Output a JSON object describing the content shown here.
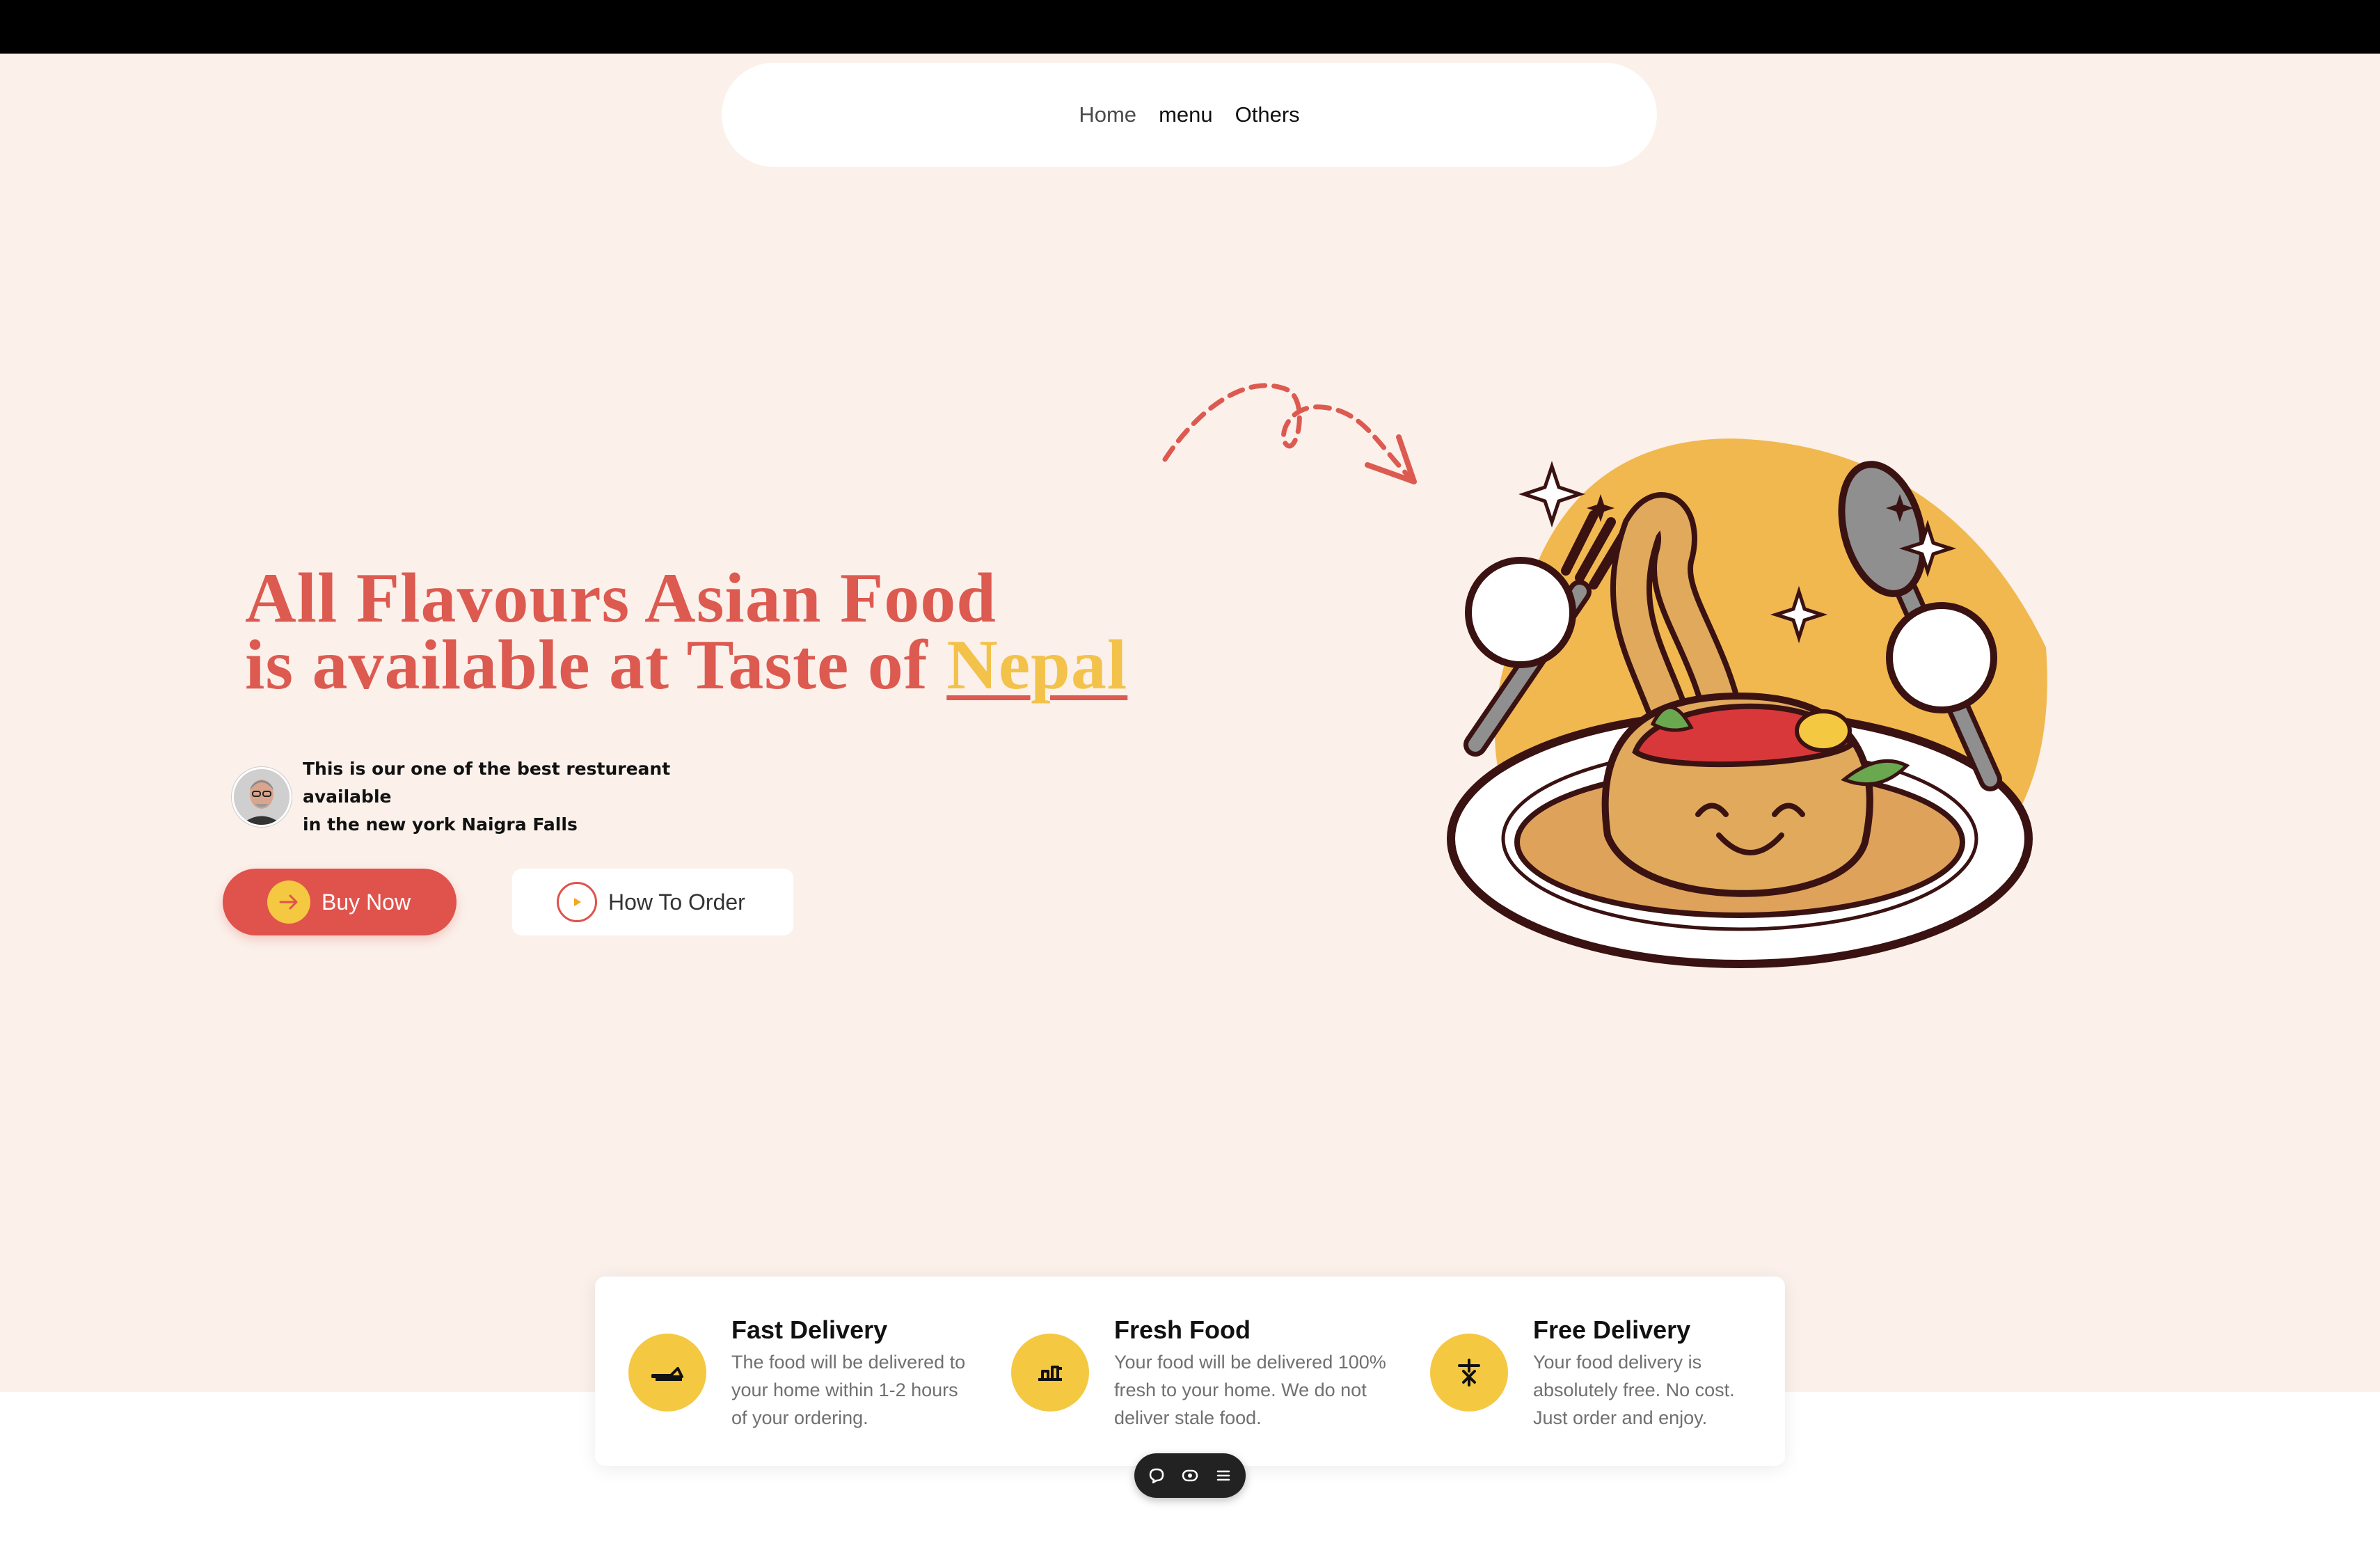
{
  "nav": {
    "items": [
      {
        "label": "Home"
      },
      {
        "label": "menu"
      },
      {
        "label": "Others"
      }
    ]
  },
  "hero": {
    "headline_line1": "All Flavours Asian Food",
    "headline_line2_prefix": "is available at Taste of ",
    "headline_highlight": "Nepal",
    "tagline_line1": "This is our one of the best restureant available",
    "tagline_line2": "in the new york Naigra Falls",
    "buy_label": "Buy Now",
    "how_label": "How To Order"
  },
  "features": [
    {
      "icon": "delivery-icon",
      "title": "Fast Delivery",
      "desc": [
        "The food will be delivered to",
        "your home within 1-2 hours",
        "of your ordering."
      ]
    },
    {
      "icon": "fresh-food-icon",
      "title": "Fresh Food",
      "desc": [
        "Your food will be delivered 100%",
        "fresh to your home. We do not",
        "deliver stale food."
      ]
    },
    {
      "icon": "free-delivery-icon",
      "title": "Free Delivery",
      "desc": [
        "Your food delivery is",
        "absolutely free. No cost.",
        "Just order and enjoy."
      ]
    }
  ],
  "colors": {
    "accent_red": "#e0524c",
    "accent_yellow": "#f5c842",
    "hero_bg": "#fbf0ea"
  },
  "toolbar": {
    "icons": [
      "comment-icon",
      "eye-icon",
      "menu-icon"
    ]
  }
}
